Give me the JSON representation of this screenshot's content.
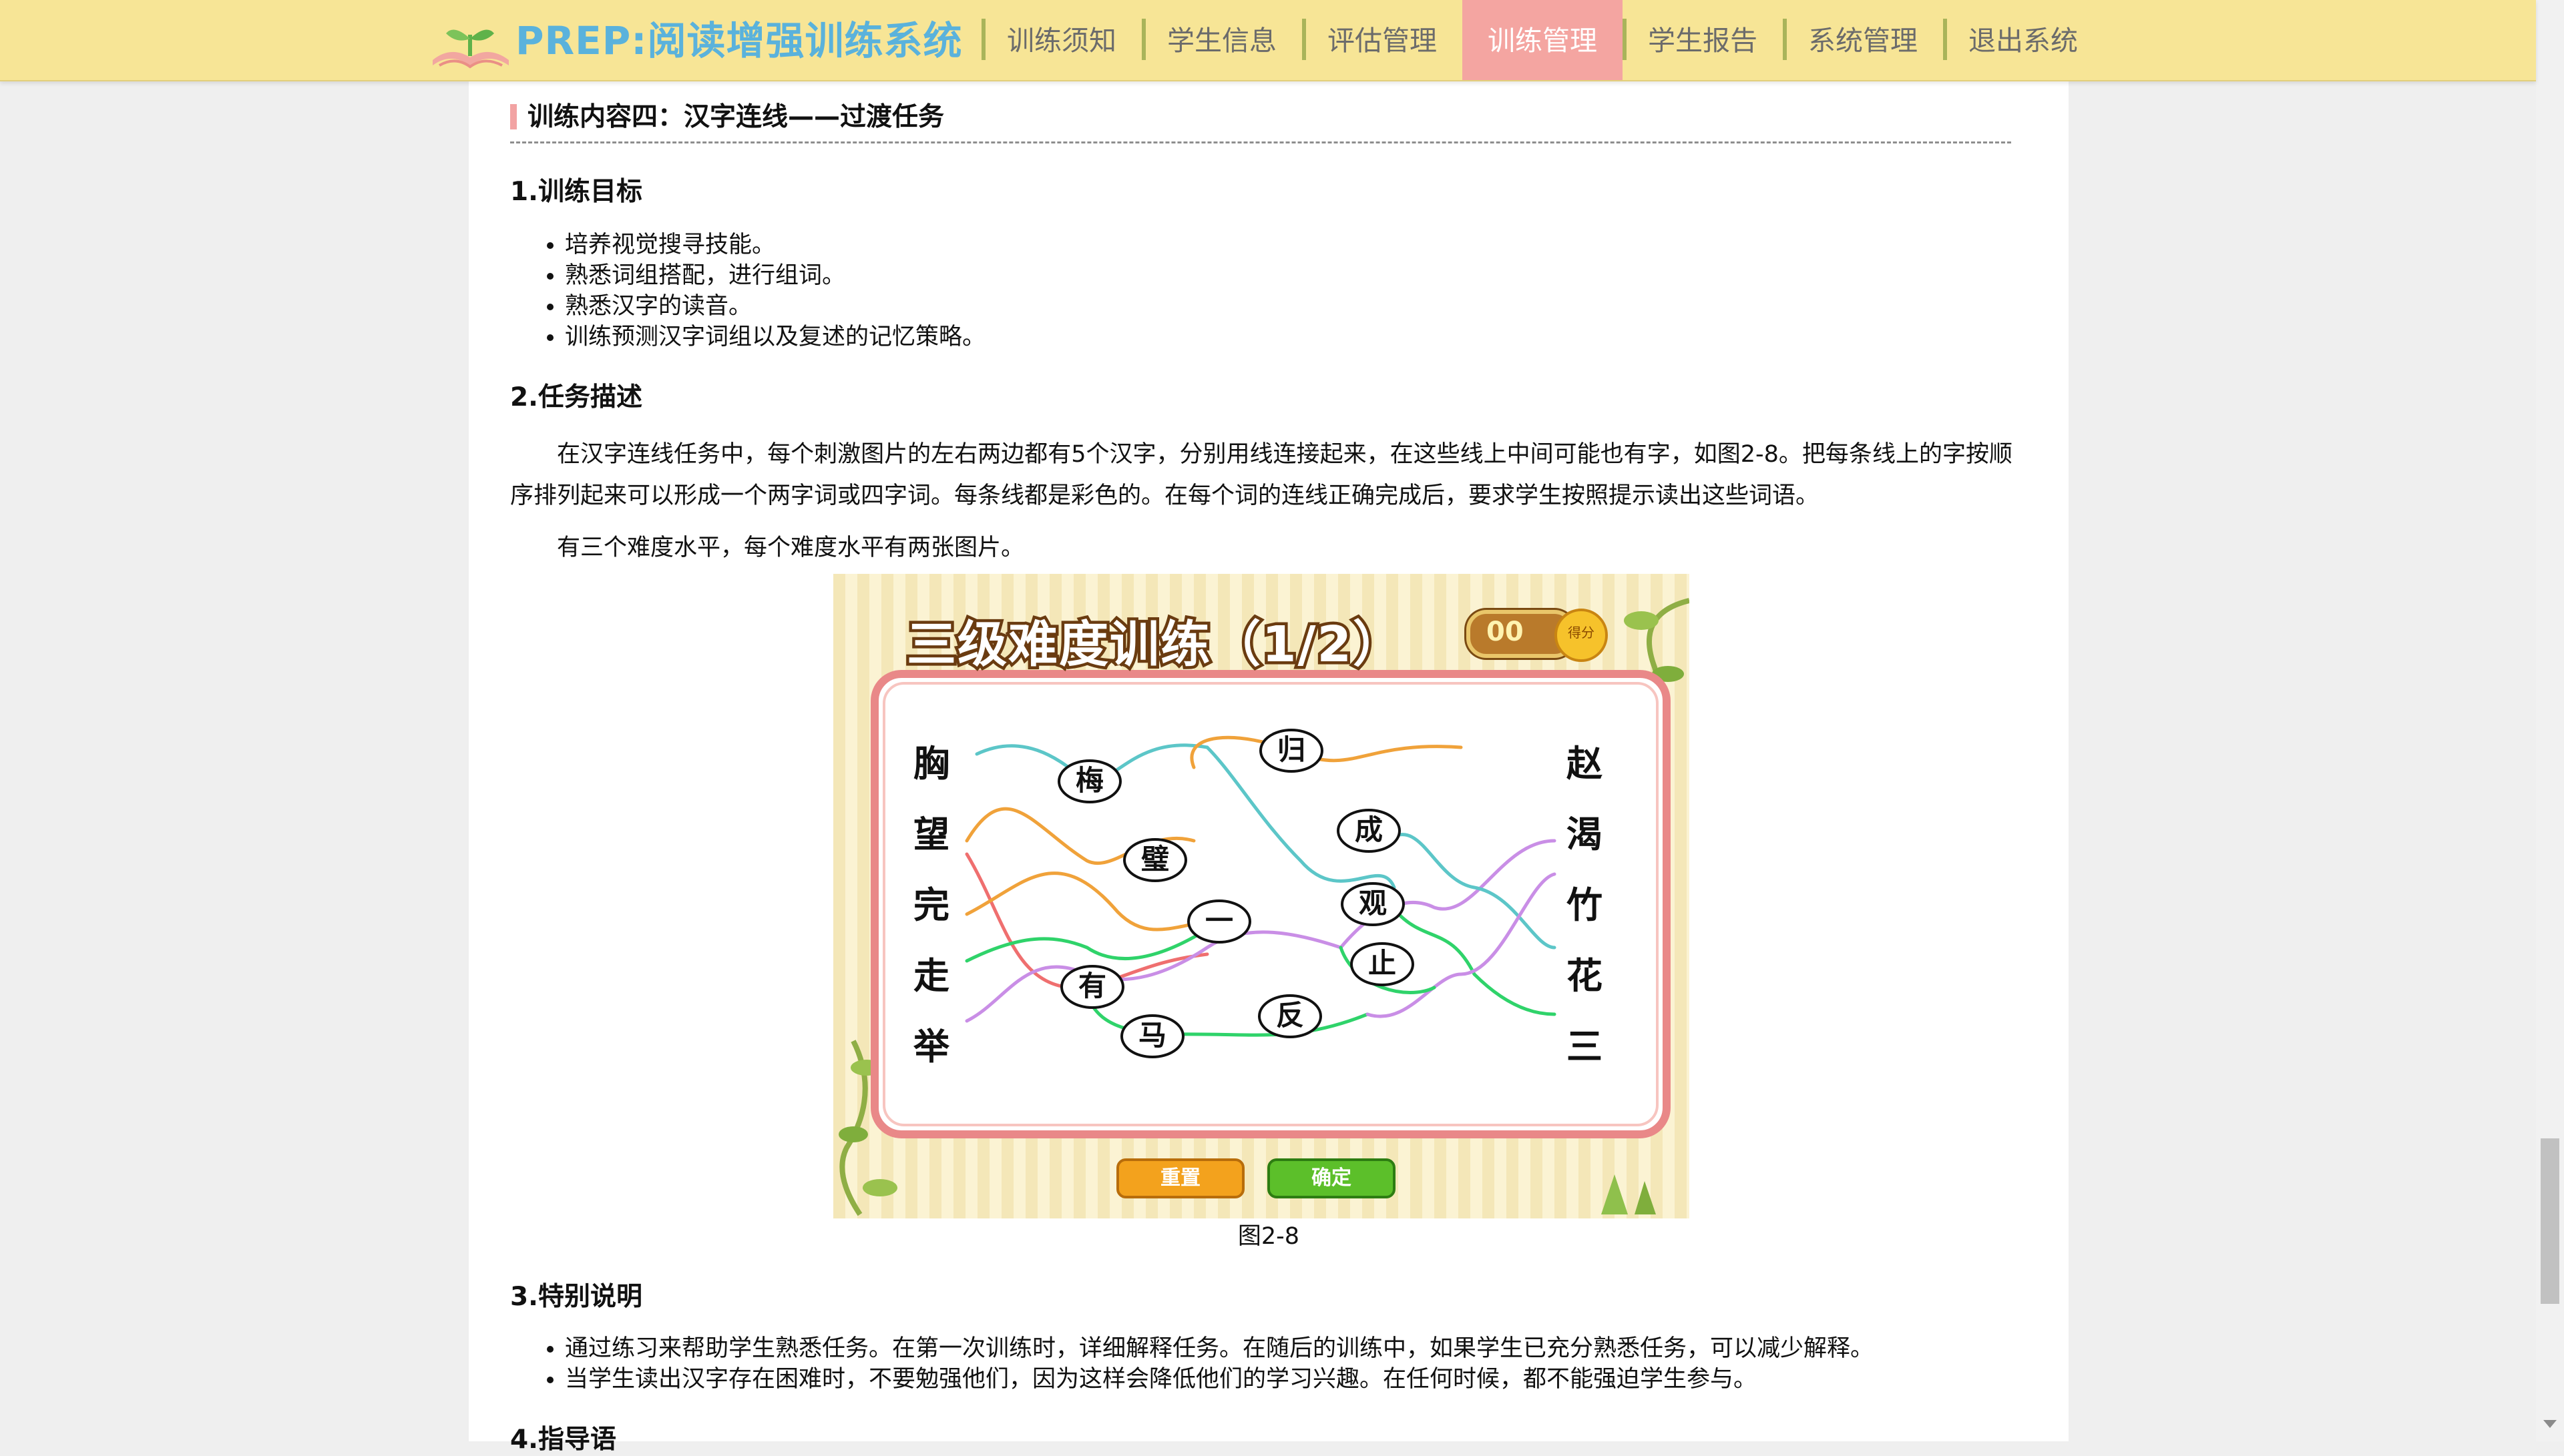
{
  "app": {
    "brand": "PREP:阅读增强训练系统",
    "nav": [
      {
        "label": "训练须知",
        "active": false
      },
      {
        "label": "学生信息",
        "active": false
      },
      {
        "label": "评估管理",
        "active": false
      },
      {
        "label": "训练管理",
        "active": true
      },
      {
        "label": "学生报告",
        "active": false
      },
      {
        "label": "系统管理",
        "active": false
      },
      {
        "label": "退出系统",
        "active": false
      }
    ]
  },
  "content": {
    "section_title": "训练内容四：汉字连线——过渡任务",
    "goal_heading": "1.训练目标",
    "goals": [
      "培养视觉搜寻技能。",
      "熟悉词组搭配，进行组词。",
      "熟悉汉字的读音。",
      "训练预测汉字词组以及复述的记忆策略。"
    ],
    "task_heading": "2.任务描述",
    "task_para1": "在汉字连线任务中，每个刺激图片的左右两边都有5个汉字，分别用线连接起来，在这些线上中间可能也有字，如图2-8。把每条线上的字按顺序排列起来可以形成一个两字词或四字词。每条线都是彩色的。在每个词的连线正确完成后，要求学生按照提示读出这些词语。",
    "task_para2": "有三个难度水平，每个难度水平有两张图片。",
    "figure": {
      "title": "三级难度训练（1/2）",
      "score": "00",
      "score_label": "得分",
      "left_chars": [
        "胸",
        "望",
        "完",
        "走",
        "举"
      ],
      "right_chars": [
        "赵",
        "渴",
        "竹",
        "花",
        "三"
      ],
      "nodes": [
        "归",
        "梅",
        "璧",
        "成",
        "观",
        "一",
        "止",
        "有",
        "反",
        "马"
      ],
      "reset_label": "重置",
      "ok_label": "确定",
      "colors": {
        "orange": "#f0a23a",
        "teal": "#5cc6c8",
        "red": "#ef6f6f",
        "purple": "#c98ee6",
        "green": "#2fd36a"
      }
    },
    "figure_caption": "图2-8",
    "notes_heading": "3.特别说明",
    "notes": [
      "通过练习来帮助学生熟悉任务。在第一次训练时，详细解释任务。在随后的训练中，如果学生已充分熟悉任务，可以减少解释。",
      "当学生读出汉字存在困难时，不要勉强他们，因为这样会降低他们的学习兴趣。在任何时候，都不能强迫学生参与。"
    ],
    "next_heading": "4.指导语"
  }
}
